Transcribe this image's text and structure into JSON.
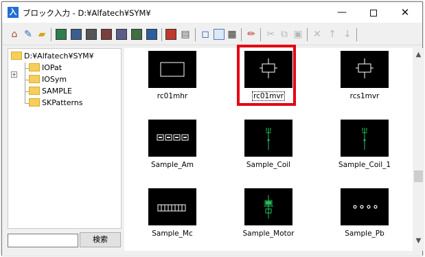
{
  "window": {
    "title": "ブロック入力 - D:¥Alfatech¥SYM¥",
    "app_icon_glyph": "入",
    "minimize_glyph": "—",
    "close_glyph": "✕"
  },
  "tree": {
    "root": "D:¥Alfatech¥SYM¥",
    "items": [
      "IOPat",
      "IOSym",
      "SAMPLE",
      "SKPatterns"
    ],
    "expander_glyph": "+"
  },
  "search": {
    "input_value": "",
    "button_label": "検索"
  },
  "blocks": [
    {
      "name": "rc01mhr",
      "icon": "rectangle-symbol"
    },
    {
      "name": "rc01mvr",
      "icon": "coil-symbol",
      "selected": true
    },
    {
      "name": "rcs1mvr",
      "icon": "coil-symbol"
    },
    {
      "name": "Sample_Am",
      "icon": "ammeter-row-symbol"
    },
    {
      "name": "Sample_Coil",
      "icon": "green-coil-symbol"
    },
    {
      "name": "Sample_Coil_1",
      "icon": "green-coil-symbol"
    },
    {
      "name": "Sample_Mc",
      "icon": "contactor-strip-symbol"
    },
    {
      "name": "Sample_Motor",
      "icon": "green-motor-symbol"
    },
    {
      "name": "Sample_Pb",
      "icon": "pushbutton-dots-symbol"
    }
  ],
  "colors": {
    "highlight": "#e60012",
    "symbol_green": "#22c55e",
    "folder": "#f5cf59"
  }
}
